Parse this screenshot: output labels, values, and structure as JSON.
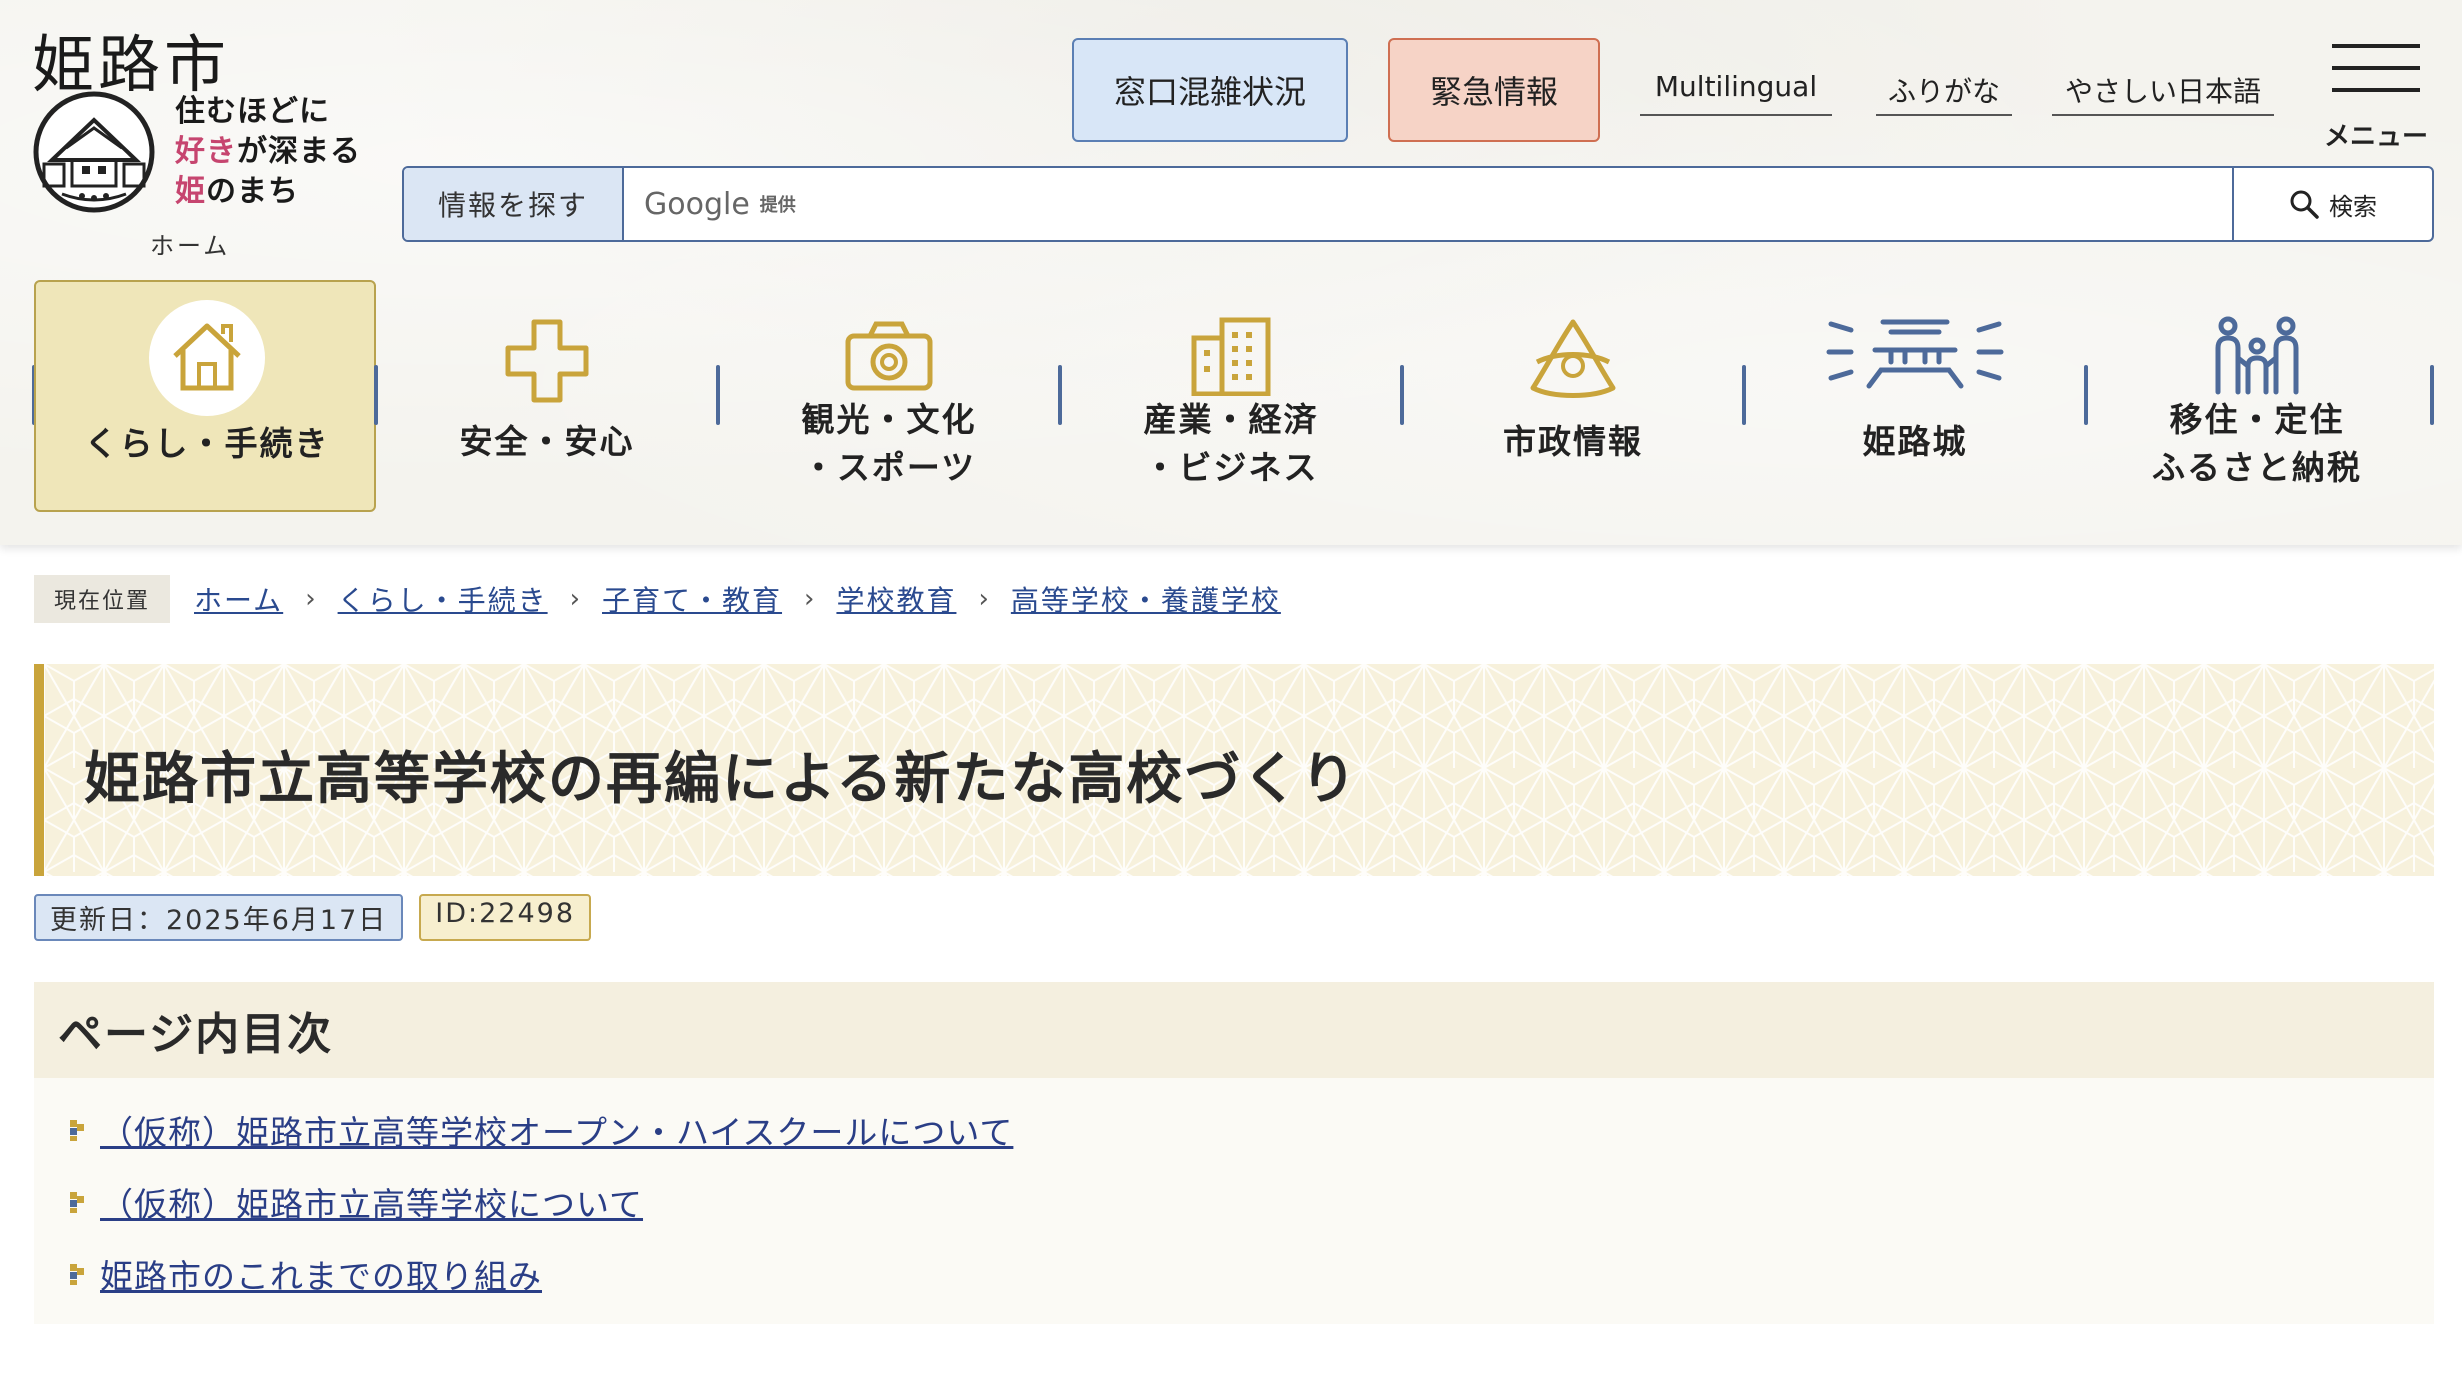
{
  "site": {
    "name": "姫路市",
    "slogan_line1": "住むほどに",
    "slogan_line2_pink": "好き",
    "slogan_line2_rest": "が深まる",
    "slogan_line3_pink": "姫",
    "slogan_line3_rest": "のまち",
    "home_label": "ホーム"
  },
  "header": {
    "crowd_button": "窓口混雑状況",
    "emergency_button": "緊急情報",
    "links": [
      "Multilingual",
      "ふりがな",
      "やさしい日本語"
    ],
    "menu_label": "メニュー"
  },
  "search": {
    "label": "情報を探す",
    "google_word": "Google",
    "provided": "提供",
    "button": "検索"
  },
  "nav": {
    "items": [
      {
        "lines": [
          "くらし・手続き"
        ],
        "icon": "house-icon",
        "active": true
      },
      {
        "lines": [
          "安全・安心"
        ],
        "icon": "cross-icon",
        "active": false
      },
      {
        "lines": [
          "観光・文化",
          "・スポーツ"
        ],
        "icon": "camera-icon",
        "active": false
      },
      {
        "lines": [
          "産業・経済",
          "・ビジネス"
        ],
        "icon": "building-icon",
        "active": false
      },
      {
        "lines": [
          "市政情報"
        ],
        "icon": "city-emblem-icon",
        "active": false
      },
      {
        "lines": [
          "姫路城"
        ],
        "icon": "castle-icon",
        "active": false
      },
      {
        "lines": [
          "移住・定住",
          "ふるさと納税"
        ],
        "icon": "family-icon",
        "active": false
      }
    ]
  },
  "breadcrumb": {
    "here_label": "現在位置",
    "items": [
      "ホーム",
      "くらし・手続き",
      "子育て・教育",
      "学校教育",
      "高等学校・養護学校"
    ],
    "separator": "›"
  },
  "page": {
    "title": "姫路市立高等学校の再編による新たな高校づくり",
    "updated": "更新日：2025年6月17日",
    "id": "ID:22498"
  },
  "toc": {
    "heading": "ページ内目次",
    "items": [
      "（仮称）姫路市立高等学校オープン・ハイスクールについて",
      "（仮称）姫路市立高等学校について",
      "姫路市のこれまでの取り組み"
    ]
  },
  "colors": {
    "accent_blue": "#4d6a9a",
    "gold": "#c9a43b",
    "link": "#2a4a8f",
    "slogan_pink": "#c6456f"
  }
}
